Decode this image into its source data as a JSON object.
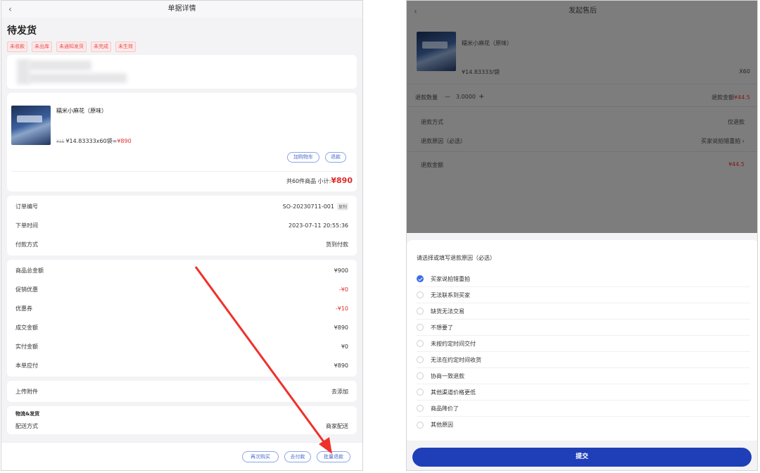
{
  "left": {
    "nav_title": "单据详情",
    "back_glyph": "‹",
    "status_title": "待发货",
    "tags": [
      "未收款",
      "未出库",
      "未通知发货",
      "未完成",
      "未生效"
    ],
    "product": {
      "name": "糯米小麻花（原味）",
      "old_price": "¥15",
      "price_qty": "¥14.83333x60袋=",
      "total": "¥890",
      "btn_cart": "加购物车",
      "btn_refund": "退款",
      "subtotal_prefix": "共60件商品  小计:",
      "subtotal": "¥890"
    },
    "order_info": [
      {
        "label": "订单编号",
        "value": "SO-20230711-001",
        "copy": "复制"
      },
      {
        "label": "下单时间",
        "value": "2023-07-11 20:55:36"
      },
      {
        "label": "付款方式",
        "value": "货到付款"
      }
    ],
    "amounts": [
      {
        "label": "商品总金额",
        "value": "¥900",
        "red": false
      },
      {
        "label": "促销优惠",
        "value": "-¥0",
        "red": true
      },
      {
        "label": "优惠券",
        "value": "-¥10",
        "red": true
      },
      {
        "label": "成交金额",
        "value": "¥890",
        "red": false
      },
      {
        "label": "实付金额",
        "value": "¥0",
        "red": false
      },
      {
        "label": "本单应付",
        "value": "¥890",
        "red": false
      }
    ],
    "attachment": {
      "label": "上传附件",
      "action": "去添加"
    },
    "logistics": {
      "heading": "物流&发货",
      "label": "配送方式",
      "value": "商家配送"
    },
    "bottom_buttons": {
      "rebuy": "再次购买",
      "pay": "去付款",
      "batch_refund": "批量退款"
    }
  },
  "right": {
    "nav_title": "发起售后",
    "back_glyph": "‹",
    "product_name": "糯米小麻花（原味）",
    "unit_price": "¥14.83333/袋",
    "qty": "X60",
    "refund_qty_label": "退款数量",
    "minus": "—",
    "refund_qty": "3.0000",
    "plus": "+",
    "refund_amount_label": "退款金额",
    "refund_amount": "¥44.5",
    "method_label": "退款方式",
    "method_value": "仅退款",
    "reason_label": "退款原因（必选）",
    "reason_value": "买家说拍错重拍 ›",
    "amount_label": "退款金额",
    "amount_value": "¥44.5",
    "sheet_title": "请选择或填写退款原因（必选）",
    "reasons": [
      "买家说拍错重拍",
      "无法联系到买家",
      "缺货无法交易",
      "不想要了",
      "未按约定时间交付",
      "无法在约定时间收货",
      "协商一致退款",
      "其他渠道价格更低",
      "商品降价了",
      "其他原因"
    ],
    "selected_index": 0,
    "submit": "提交"
  },
  "colors": {
    "accent": "#3b6ce8",
    "submit_bg": "#1f3fb8",
    "price_red": "#e02b2b",
    "arrow_red": "#f0302a"
  }
}
